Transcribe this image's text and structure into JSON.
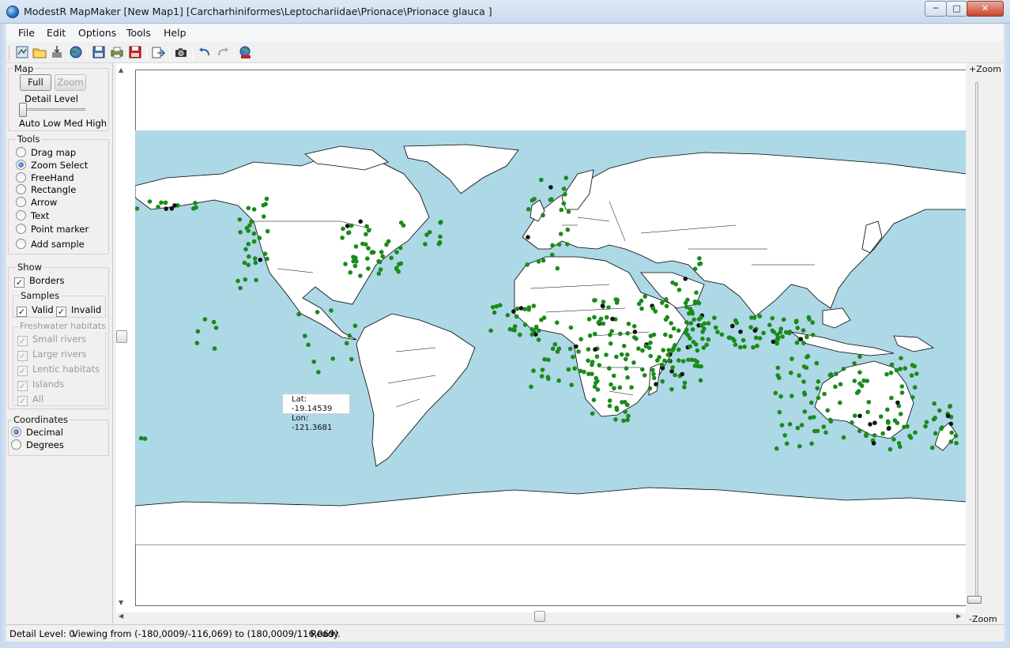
{
  "window": {
    "title": "ModestR MapMaker [New Map1] [Carcharhiniformes\\Leptochariidae\\Prionace\\Prionace glauca ]",
    "controls": {
      "minimize": "─",
      "maximize": "□",
      "close": "✕"
    }
  },
  "menu": [
    "File",
    "Edit",
    "Options",
    "Tools",
    "Help"
  ],
  "toolbar": {
    "icons": [
      "new-map-icon",
      "open-folder-icon",
      "import-icon",
      "web-globe-icon",
      "save-disk-icon",
      "print-icon",
      "save-red-disk-icon",
      "export-icon",
      "camera-icon",
      "undo-icon",
      "redo-icon",
      "globe-search-icon"
    ]
  },
  "left_panel": {
    "map_group": {
      "label": "Map",
      "full_button": "Full",
      "zoom_button": "Zoom"
    },
    "detail": {
      "label": "Detail Level",
      "scale": "Auto Low Med High",
      "level": "Auto"
    },
    "tools": {
      "label": "Tools",
      "selected": "Zoom Select",
      "items": [
        "Drag map",
        "Zoom Select",
        "FreeHand",
        "Rectangle",
        "Arrow",
        "Text",
        "Point marker",
        "Add sample"
      ]
    },
    "show": {
      "label": "Show",
      "borders": "Borders",
      "borders_checked": true,
      "samples_label": "Samples",
      "valid": "Valid",
      "valid_checked": true,
      "invalid": "Invalid",
      "invalid_checked": true,
      "freshwater_label": "Freshwater habitats",
      "freshwater_items": [
        "Small rivers",
        "Large rivers",
        "Lentic habitats",
        "Islands",
        "All"
      ]
    },
    "coordinates": {
      "label": "Coordinates",
      "selected": "Decimal",
      "items": [
        "Decimal",
        "Degrees"
      ]
    }
  },
  "map": {
    "tooltip_lat": "Lat: -19.14539",
    "tooltip_lon": "Lon: -121.3681",
    "colors": {
      "ocean": "#add8e6",
      "land": "#ffffff",
      "valid_sample": "#1a8a1a",
      "invalid_sample": "#111111"
    }
  },
  "zoom": {
    "plus_label": "+Zoom",
    "minus_label": "-Zoom",
    "level": 0
  },
  "status": {
    "detail": "Detail Level: 0",
    "viewing": "Viewing from (-180,0009/-116,069) to (180,0009/116,069)",
    "state": "Ready."
  }
}
